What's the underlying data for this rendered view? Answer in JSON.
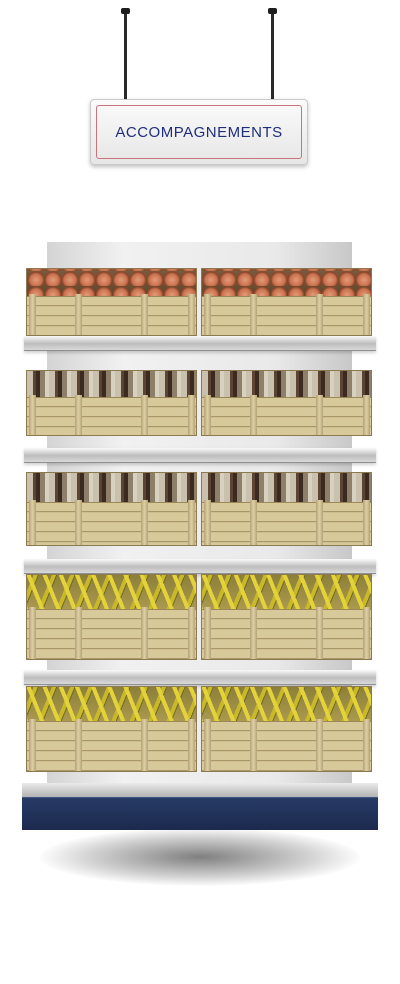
{
  "sign": {
    "label": "ACCOMPAGNEMENTS"
  },
  "shelves": [
    {
      "product": "eggs"
    },
    {
      "product": "fish"
    },
    {
      "product": "fish"
    },
    {
      "product": "banana"
    },
    {
      "product": "banana"
    }
  ],
  "colors": {
    "sign_text": "#1f2e7a",
    "sign_border": "#c9747c",
    "base": "#1b2a4d",
    "crate_wood": "#d9c99a"
  }
}
